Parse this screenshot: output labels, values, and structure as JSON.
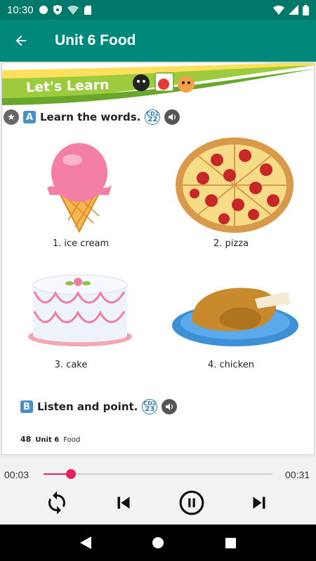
{
  "status_bar": {
    "time": "10:30"
  },
  "app_bar": {
    "title": "Unit 6 Food"
  },
  "page": {
    "banner_title": "Let's Learn",
    "section_a": {
      "letter": "A",
      "text": "Learn the words.",
      "cd_label": "CD2",
      "cd_track": "22"
    },
    "items": [
      {
        "label": "1. ice cream"
      },
      {
        "label": "2. pizza"
      },
      {
        "label": "3. cake"
      },
      {
        "label": "4. chicken"
      }
    ],
    "section_b": {
      "letter": "B",
      "text": "Listen and point.",
      "cd_label": "CD2",
      "cd_track": "23"
    },
    "footer": {
      "page_number": "48",
      "unit": "Unit 6",
      "topic": "Food"
    }
  },
  "player": {
    "current_time": "00:03",
    "total_time": "00:31",
    "progress": 0.12
  },
  "colors": {
    "app_bar": "#00897b",
    "status_bar": "#00796b",
    "accent": "#e91e63"
  }
}
